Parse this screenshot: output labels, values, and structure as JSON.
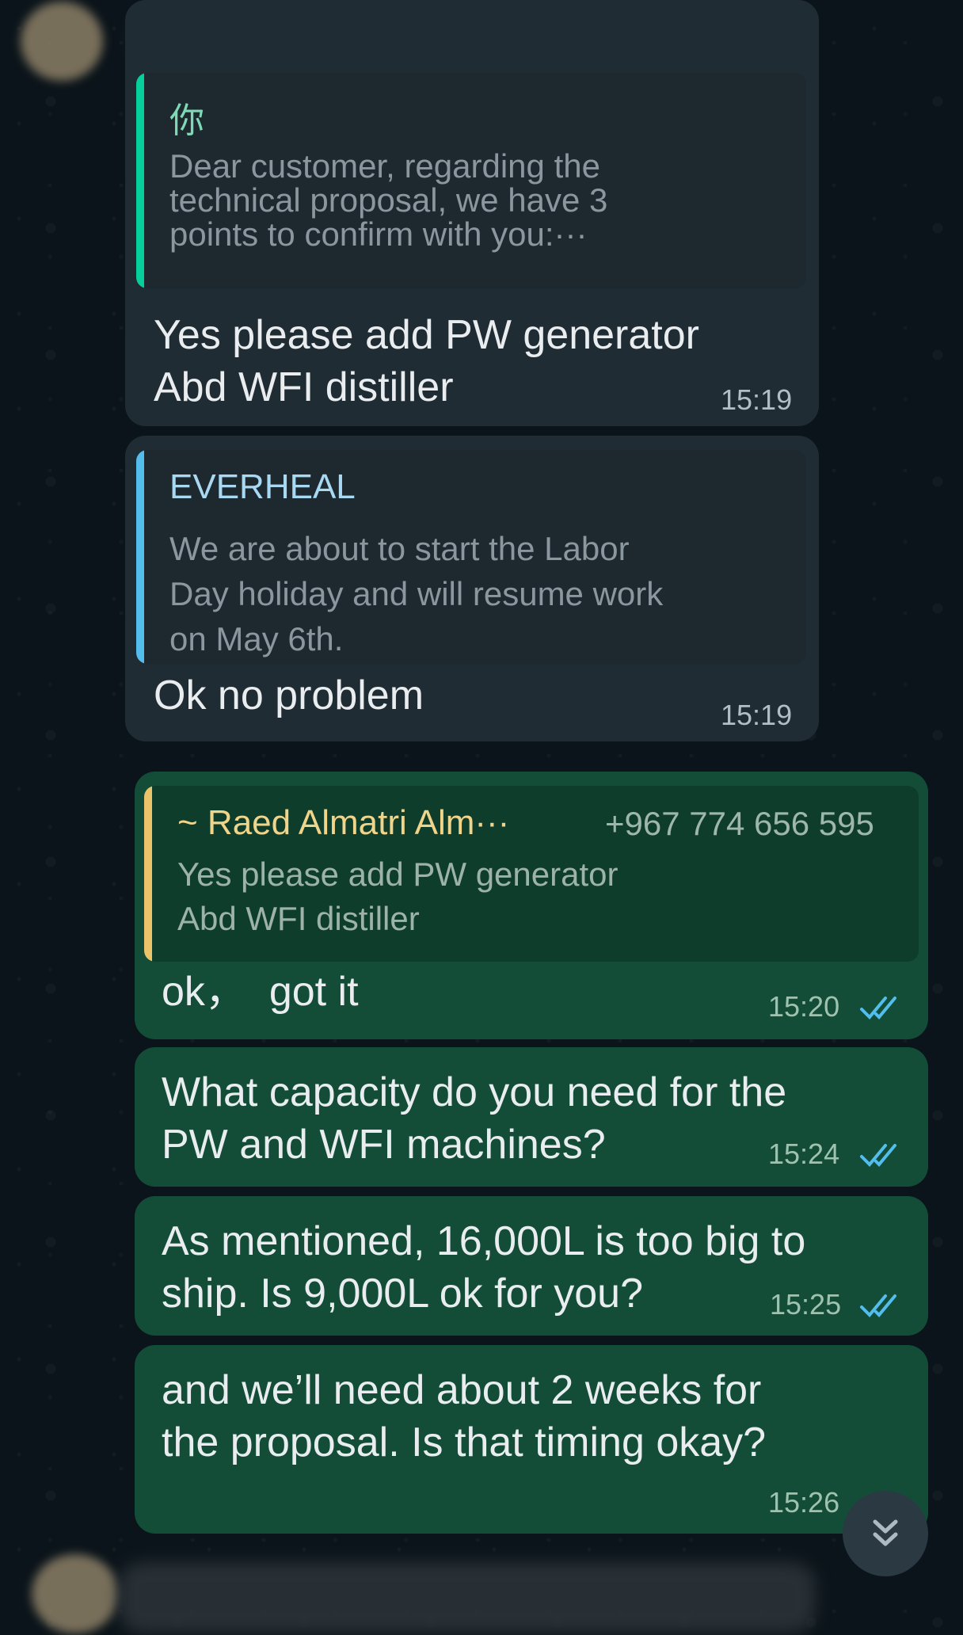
{
  "messages": [
    {
      "direction": "incoming",
      "quote": {
        "sender": "你",
        "sender_color": "#53bdeb",
        "bar_color": "#06cf9c",
        "text": "Dear customer, regarding the\ntechnical proposal, we have 3\npoints to confirm with you:···"
      },
      "text": "Yes please add PW generator\nAbd WFI distiller",
      "time": "15:19"
    },
    {
      "direction": "incoming",
      "quote": {
        "sender": "EVERHEAL",
        "sender_color": "#53bdeb",
        "bar_color": "#53bdeb",
        "text": "We are about to start the Labor\nDay holiday and will resume work\non May 6th."
      },
      "text": "Ok no problem",
      "time": "15:19"
    },
    {
      "direction": "outgoing",
      "quote": {
        "sender": "~ Raed Almatri Alm···",
        "sender_color": "#e9c46a",
        "bar_color": "#e9c46a",
        "phone": "+967 774 656 595",
        "text": "Yes please add PW generator\nAbd WFI distiller"
      },
      "text": "ok，  got it",
      "time": "15:20",
      "status": "read"
    },
    {
      "direction": "outgoing",
      "text": "What capacity do you need for the\nPW and WFI machines?",
      "time": "15:24",
      "status": "read"
    },
    {
      "direction": "outgoing",
      "text": "As mentioned, 16,000L is too big to\nship. Is 9,000L ok for you?",
      "time": "15:25",
      "status": "read"
    },
    {
      "direction": "outgoing",
      "text": "and we’ll need about 2 weeks for\nthe proposal. Is that timing okay?",
      "time": "15:26",
      "status": "read"
    }
  ],
  "colors": {
    "background": "#0b141a",
    "incoming_bubble": "#202c33",
    "outgoing_bubble": "#144d37",
    "read_ticks": "#53bdeb"
  },
  "icons": {
    "scroll_down": "double-chevron-down-icon",
    "read_receipt": "double-check-icon"
  }
}
